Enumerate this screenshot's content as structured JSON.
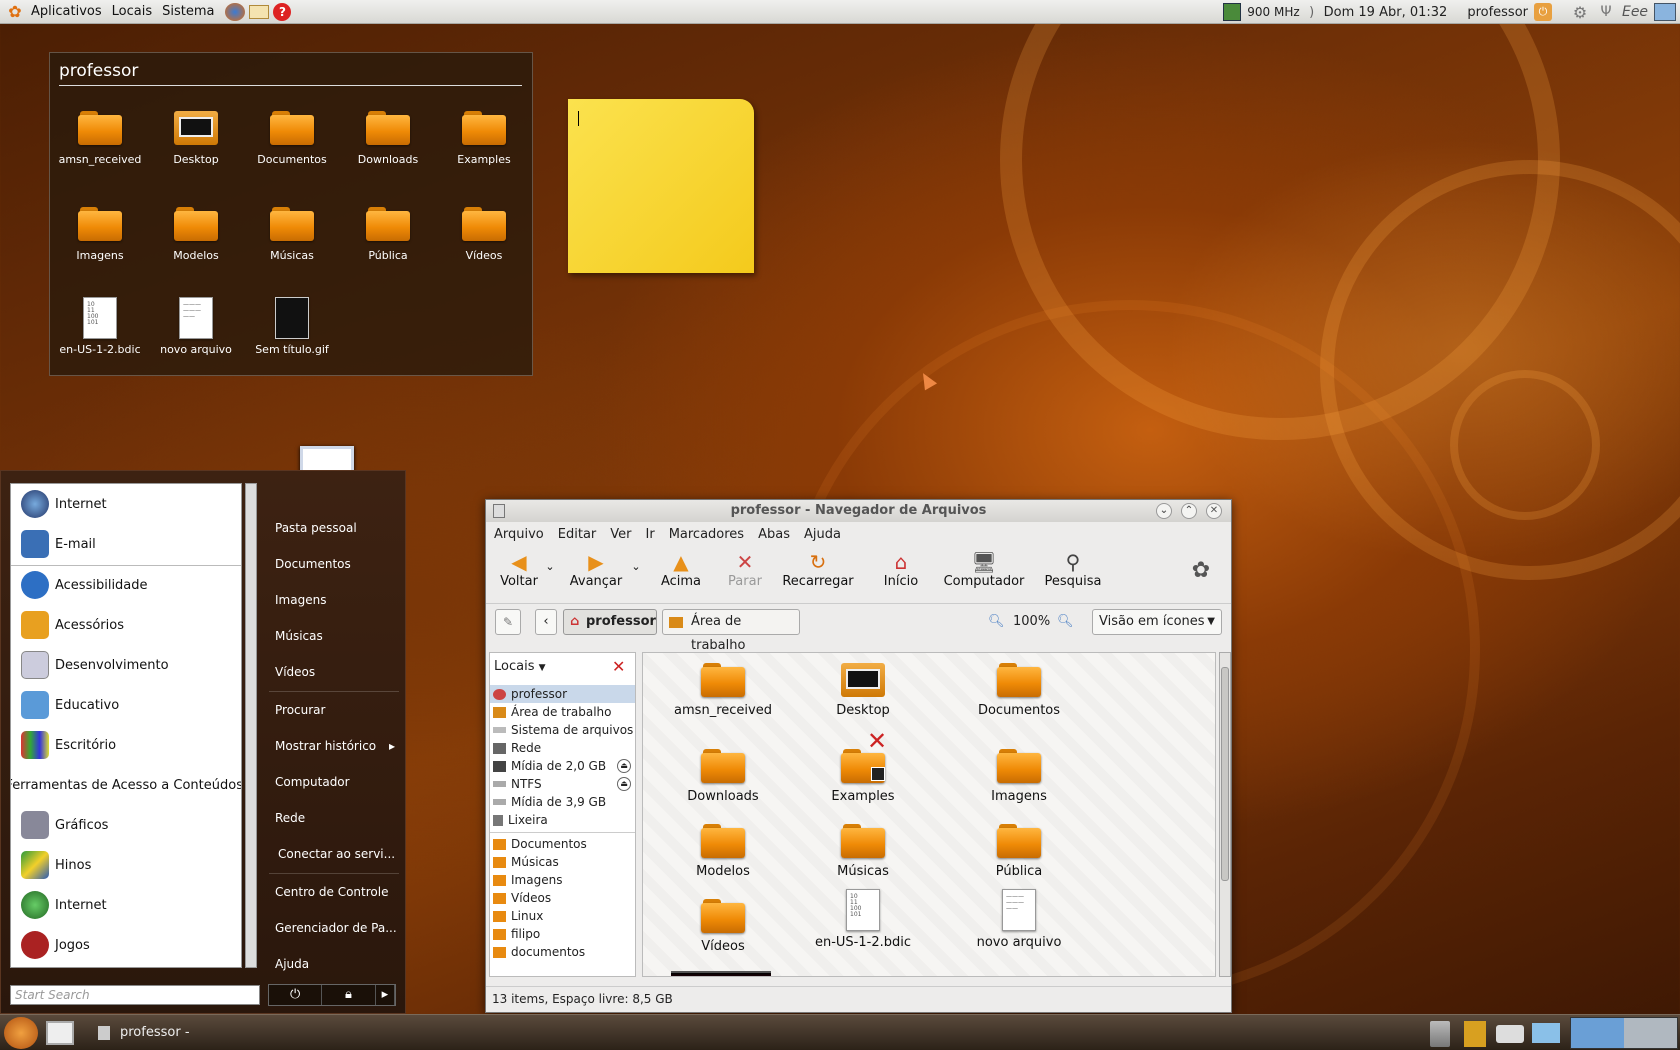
{
  "top_panel": {
    "menus": [
      "Aplicativos",
      "Locais",
      "Sistema"
    ],
    "cpu": "900 MHz",
    "datetime": "Dom 19 Abr, 01:32",
    "user": "professor"
  },
  "folder_widget": {
    "title": "professor",
    "items": [
      "amsn_received",
      "Desktop",
      "Documentos",
      "Downloads",
      "Examples",
      "Imagens",
      "Modelos",
      "Músicas",
      "Pública",
      "Vídeos",
      "en-US-1-2.bdic",
      "novo arquivo",
      "Sem título.gif"
    ]
  },
  "start_menu": {
    "apps": [
      "Internet",
      "E-mail",
      "Acessibilidade",
      "Acessórios",
      "Desenvolvimento",
      "Educativo",
      "Escritório",
      "Ferramentas de Acesso a Conteúdos",
      "Gráficos",
      "Hinos",
      "Internet",
      "Jogos"
    ],
    "places": [
      "Pasta pessoal",
      "Documentos",
      "Imagens",
      "Músicas",
      "Vídeos",
      "Procurar",
      "Mostrar histórico",
      "Computador",
      "Rede",
      "Conectar ao servi...",
      "Centro de Controle",
      "Gerenciador de Pa...",
      "Ajuda"
    ],
    "search_placeholder": "Start Search"
  },
  "file_manager": {
    "title": "professor - Navegador de Arquivos",
    "menu": [
      "Arquivo",
      "Editar",
      "Ver",
      "Ir",
      "Marcadores",
      "Abas",
      "Ajuda"
    ],
    "toolbar": [
      "Voltar",
      "Avançar",
      "Acima",
      "Parar",
      "Recarregar",
      "Início",
      "Computador",
      "Pesquisa"
    ],
    "path": [
      "professor",
      "Área de trabalho"
    ],
    "zoom": "100%",
    "view_mode": "Visão em ícones",
    "sidebar_title": "Locais",
    "sidebar": [
      "professor",
      "Área de trabalho",
      "Sistema de arquivos",
      "Rede",
      "Mídia de 2,0 GB",
      "NTFS",
      "Mídia de 3,9 GB",
      "Lixeira",
      "Documentos",
      "Músicas",
      "Imagens",
      "Vídeos",
      "Linux",
      "filipo",
      "documentos"
    ],
    "items": [
      "amsn_received",
      "Desktop",
      "Documentos",
      "Downloads",
      "Examples",
      "Imagens",
      "Modelos",
      "Músicas",
      "Pública",
      "Vídeos",
      "en-US-1-2.bdic",
      "novo arquivo"
    ],
    "status": "13 items, Espaço livre: 8,5 GB"
  },
  "taskbar": {
    "task": "professor - Navegador..."
  }
}
